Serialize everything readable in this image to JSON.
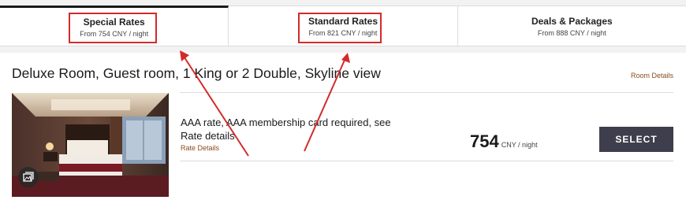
{
  "tabs": [
    {
      "label": "Special Rates",
      "sub": "From 754 CNY / night",
      "active": true
    },
    {
      "label": "Standard Rates",
      "sub": "From 821 CNY / night",
      "active": false
    },
    {
      "label": "Deals & Packages",
      "sub": "From 888 CNY / night",
      "active": false
    }
  ],
  "room": {
    "title": "Deluxe Room, Guest room, 1 King or 2 Double, Skyline view",
    "details_link": "Room Details"
  },
  "rate": {
    "name": "AAA rate, AAA membership card required, see Rate details",
    "details_link": "Rate Details",
    "price": "754",
    "unit": "CNY / night",
    "select_label": "SELECT"
  },
  "icons": {
    "gallery": "gallery-icon"
  },
  "colors": {
    "annotation": "#d42a2a",
    "link": "#8a4a1c",
    "button": "#3e3e4c"
  }
}
